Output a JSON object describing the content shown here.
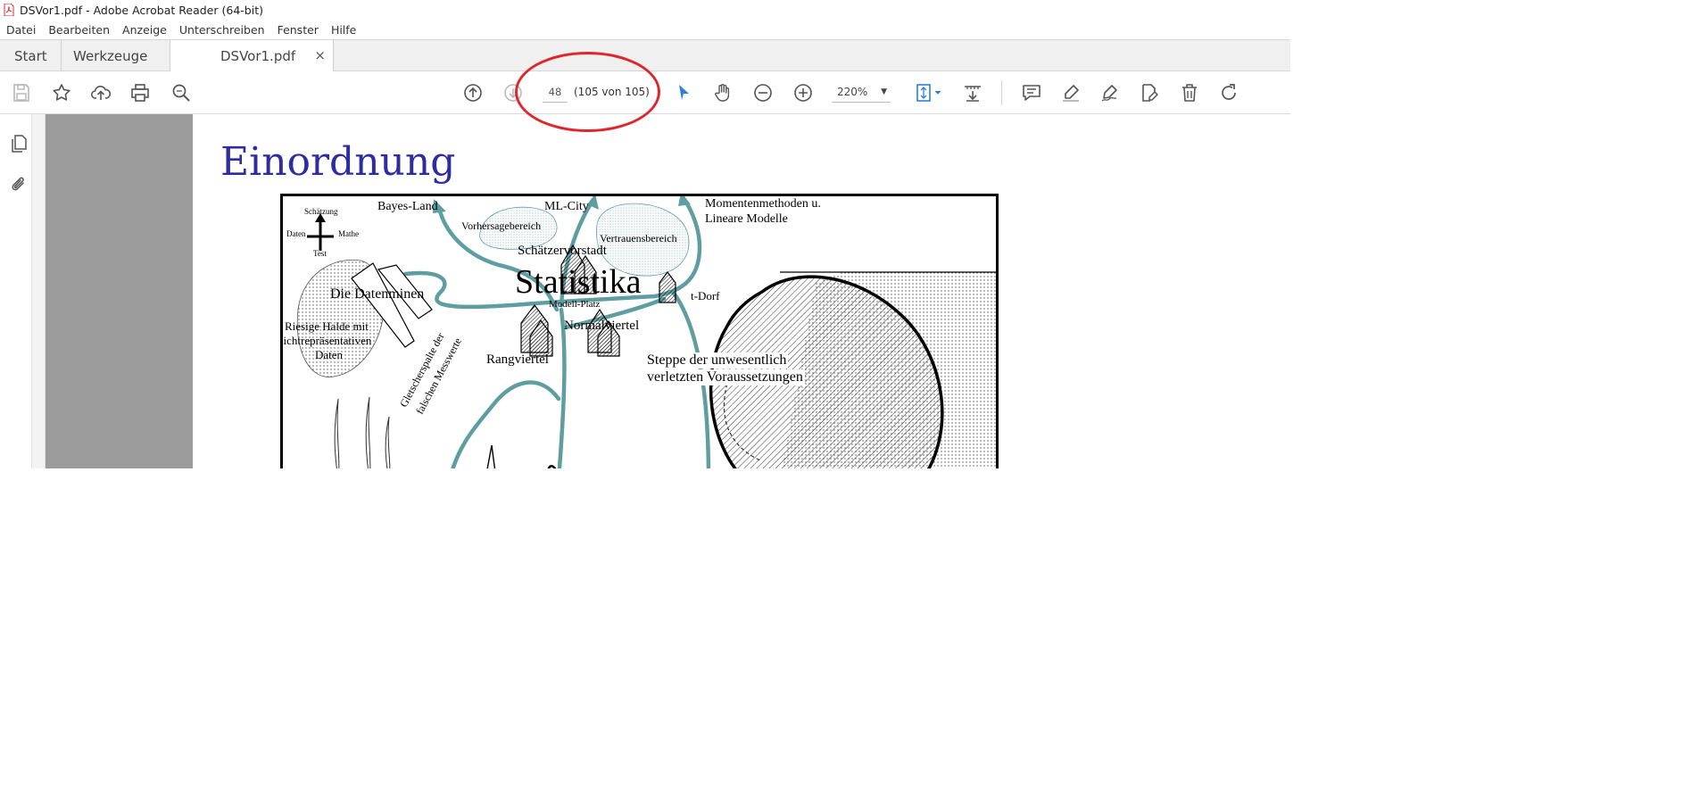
{
  "window": {
    "title": "DSVor1.pdf - Adobe Acrobat Reader (64-bit)"
  },
  "menu": [
    "Datei",
    "Bearbeiten",
    "Anzeige",
    "Unterschreiben",
    "Fenster",
    "Hilfe"
  ],
  "tabs": {
    "start": "Start",
    "tools": "Werkzeuge",
    "document": "DSVor1.pdf",
    "close": "×"
  },
  "toolbar": {
    "page_input": "48",
    "page_count": "(105 von 105)",
    "zoom": "220%",
    "zoom_caret": "▼"
  },
  "colors": {
    "accent_blue": "#2f7fd6",
    "annotation_red": "#e0262d",
    "slide_title": "#2e2c9f",
    "teal_path": "#5f9ea0"
  },
  "slide": {
    "title": "Einordnung",
    "labels": {
      "schaetzung": "Schätzung",
      "daten_axis": "Daten",
      "mathe_axis": "Mathe",
      "test": "Test",
      "bayes": "Bayes-Land",
      "vorhersage": "Vorhersagebereich",
      "mlcity": "ML-City",
      "vertrauen": "Vertrauensbereich",
      "momenten": "Momentenmethoden u.",
      "lineare": "Lineare Modelle",
      "schaetzervorstadt": "Schätzervorstadt",
      "statistika": "Statistika",
      "modellplatz": "Modell-Platz",
      "datenminen": "Die Datenminen",
      "tdorf": "t-Dorf",
      "halde1": "Riesige Halde mit",
      "halde2": "nichtrepräsentativen",
      "halde3": "Daten",
      "normalviertel": "Normalviertel",
      "gletscher1": "Gletscherspalte der",
      "gletscher2": "falschen Messwerte",
      "rangviertel": "Rangviertel",
      "steppe1": "Steppe der unwesentlich",
      "steppe2": "verletzten Voraussetzungen"
    }
  }
}
